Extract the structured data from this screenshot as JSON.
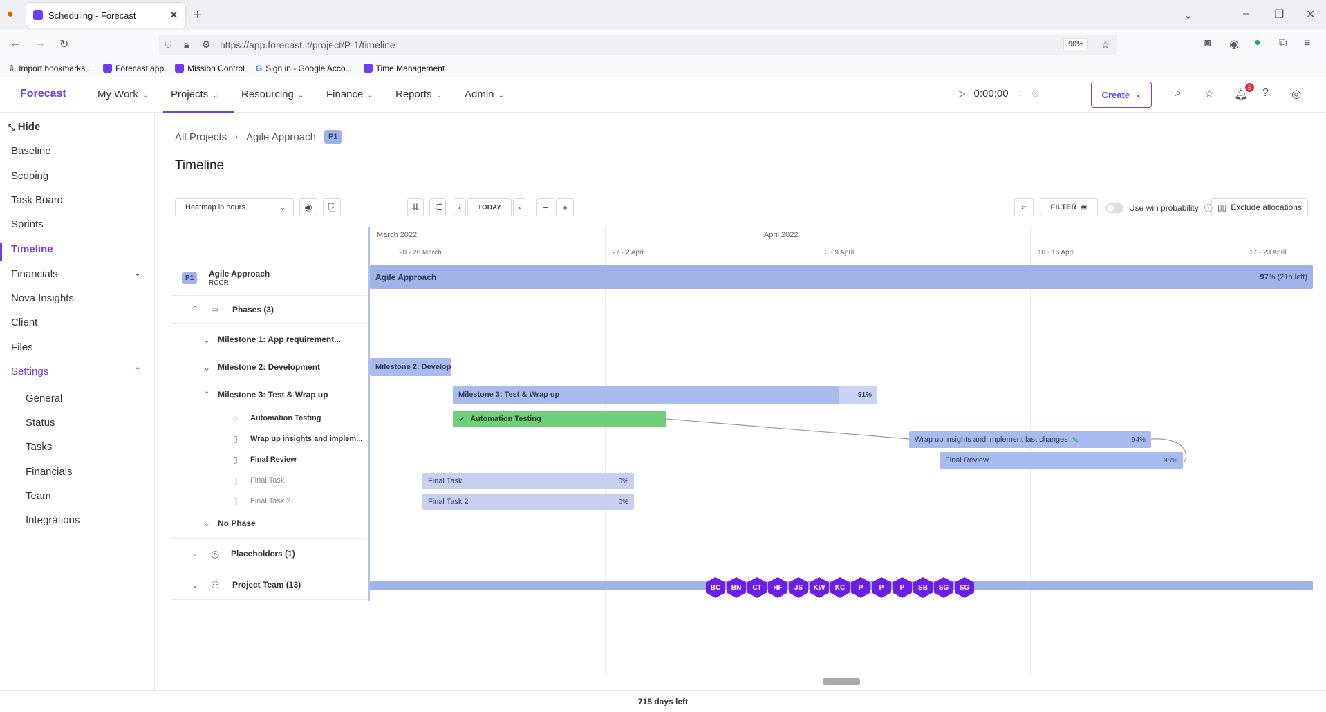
{
  "browser": {
    "tab_title": "Scheduling - Forecast",
    "url": "https://app.forecast.it/project/P-1/timeline",
    "zoom": "90%",
    "bookmarks": [
      "Import bookmarks...",
      "Forecast.app",
      "Mission Control",
      "Sign in - Google Acco...",
      "Time Management"
    ]
  },
  "appnav": {
    "logo": "Forecast",
    "items": [
      "My Work",
      "Projects",
      "Resourcing",
      "Finance",
      "Reports",
      "Admin"
    ],
    "timer": "0:00:00",
    "create_label": "Create",
    "notification_count": "5"
  },
  "sidebar": {
    "hide_label": "Hide",
    "items": [
      "Baseline",
      "Scoping",
      "Task Board",
      "Sprints",
      "Timeline",
      "Financials",
      "Nova Insights",
      "Client",
      "Files",
      "Settings"
    ],
    "settings_items": [
      "General",
      "Status",
      "Tasks",
      "Financials",
      "Team",
      "Integrations"
    ]
  },
  "breadcrumb": {
    "all_projects": "All Projects",
    "project": "Agile Approach",
    "badge": "P1"
  },
  "page_title": "Timeline",
  "toolbar": {
    "heatmap_select": "Heatmap in hours",
    "today_label": "TODAY",
    "filter_label": "FILTER",
    "win_probability_label": "Use win probability",
    "exclude_label": "Exclude allocations"
  },
  "timeline": {
    "months": [
      "March 2022",
      "April 2022"
    ],
    "weeks": [
      "20 - 26 March",
      "27 - 2 April",
      "3 - 9 April",
      "10 - 16 April",
      "17 - 23 April"
    ]
  },
  "left_panel": {
    "project_badge": "P1",
    "project_name": "Agile Approach",
    "project_client": "RCCR",
    "phases_label": "Phases (3)",
    "milestone1": "Milestone 1: App requirement...",
    "milestone2": "Milestone 2: Development",
    "milestone3": "Milestone 3: Test & Wrap up",
    "task_automation": "Automation Testing",
    "task_wrapup": "Wrap up insights and implem...",
    "task_final_review": "Final Review",
    "task_final_task": "Final Task",
    "task_final_task2": "Final Task 2",
    "no_phase": "No Phase",
    "placeholders": "Placeholders (1)",
    "project_team": "Project Team (13)"
  },
  "bars": {
    "project": {
      "label": "Agile Approach",
      "pct": "97%",
      "extra": "(21h left)"
    },
    "milestone2": {
      "label": "Milestone 2: Develop..."
    },
    "milestone3": {
      "label": "Milestone 3: Test & Wrap up",
      "pct": "91%"
    },
    "automation": {
      "label": "Automation Testing"
    },
    "wrapup": {
      "label": "Wrap up insights and implement last changes",
      "pct": "94%"
    },
    "final_review": {
      "label": "Final Review",
      "pct": "98%"
    },
    "final_task": {
      "label": "Final Task",
      "pct": "0%"
    },
    "final_task2": {
      "label": "Final Task 2",
      "pct": "0%"
    }
  },
  "team_avatars": [
    "BC",
    "BN",
    "CT",
    "HF",
    "JS",
    "KW",
    "KC",
    "P",
    "P",
    "P",
    "SB",
    "SG",
    "SG"
  ],
  "footer": "715 days left",
  "colors": {
    "accent": "#6e3ef0",
    "project_bar": "#a0b3e8",
    "milestone_bar": "#a9bbee",
    "automation_bar": "#6ed17a",
    "task_bar": "#c6d1f2",
    "avatar": "#6e1de8"
  }
}
